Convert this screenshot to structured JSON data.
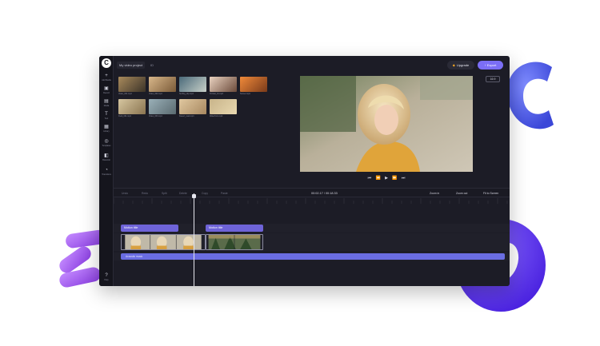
{
  "app": {
    "logo_letter": "C"
  },
  "sidebar": {
    "items": [
      {
        "icon": "plus-icon",
        "glyph": "+",
        "label": "Add Media"
      },
      {
        "icon": "record-icon",
        "glyph": "▣",
        "label": "Record"
      },
      {
        "icon": "file-icon",
        "glyph": "▤",
        "label": "Media"
      },
      {
        "icon": "text-icon",
        "glyph": "T",
        "label": "Text"
      },
      {
        "icon": "library-icon",
        "glyph": "▦",
        "label": "Library"
      },
      {
        "icon": "templates-icon",
        "glyph": "◎",
        "label": "Templates"
      },
      {
        "icon": "brandkit-icon",
        "glyph": "◧",
        "label": "Brand kit"
      },
      {
        "icon": "transitions-icon",
        "glyph": "◔",
        "label": "Transitions"
      },
      {
        "icon": "help-icon",
        "glyph": "?",
        "label": "Help"
      }
    ]
  },
  "topbar": {
    "project_name": "My video project",
    "project_suffix": "ID",
    "upgrade_label": "Upgrade",
    "export_label": "Export"
  },
  "media": [
    {
      "name": "Video_001.mp4",
      "tone": "beach"
    },
    {
      "name": "Video_002.mp4",
      "tone": "dog"
    },
    {
      "name": "Surfing_clip.mp4",
      "tone": "surf"
    },
    {
      "name": "Portrait_01.mp4",
      "tone": "portrait"
    },
    {
      "name": "Sunset.mp4",
      "tone": "sunset"
    },
    {
      "name": "Field_001.mp4",
      "tone": "field"
    },
    {
      "name": "Video_003.mp4",
      "tone": "road"
    },
    {
      "name": "Desert_road.mp4",
      "tone": "desert"
    },
    {
      "name": "Waterfront.mp4",
      "tone": "tower"
    }
  ],
  "preview": {
    "aspect_label": "16:9"
  },
  "controls": {
    "glyphs": "⏮ ⏪ ▶ ⏩ ⏭"
  },
  "toolbar": {
    "undo": "Undo",
    "redo": "Redo",
    "split": "Split",
    "delete": "Delete",
    "copy": "Copy",
    "paste": "Paste",
    "timecode": "00:02.17 / 00:18.33",
    "zoom_in": "Zoom in",
    "zoom_out": "Zoom out",
    "fit": "Fit to Screen"
  },
  "timeline": {
    "title_clip_1": "Motion title",
    "title_clip_2": "Motion title",
    "audio_track": "Acoustic music"
  },
  "colors": {
    "accent": "#7b6ef6",
    "panel": "#1c1c26",
    "audio": "#6a6de2",
    "deco_blue": "#5b6af0",
    "deco_purple": "#9b5cf0",
    "deco_violet": "#6b3ef5"
  }
}
